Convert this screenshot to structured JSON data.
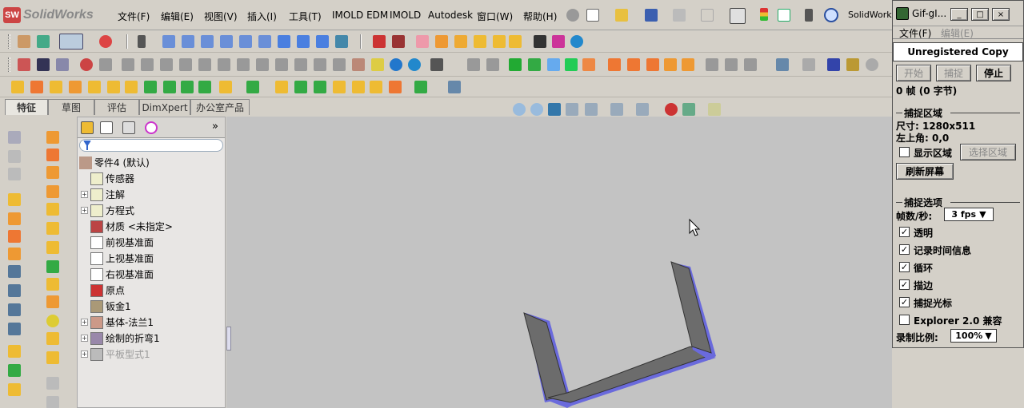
{
  "app": {
    "name": "SolidWorks",
    "logo_letters": "SW"
  },
  "menu": [
    "文件(F)",
    "编辑(E)",
    "视图(V)",
    "插入(I)",
    "工具(T)",
    "IMOLD EDM",
    "IMOLD",
    "Autodesk",
    "窗口(W)",
    "帮助(H)"
  ],
  "search": {
    "label": "SolidWorks"
  },
  "tabs": [
    "特征",
    "草图",
    "评估",
    "DimXpert",
    "办公室产品"
  ],
  "tree": {
    "root": "零件4 (默认)",
    "items": [
      {
        "label": "传感器",
        "expand": false
      },
      {
        "label": "注解",
        "expand": true
      },
      {
        "label": "方程式",
        "expand": true
      },
      {
        "label": "材质 <未指定>",
        "expand": false
      },
      {
        "label": "前视基准面",
        "expand": false
      },
      {
        "label": "上视基准面",
        "expand": false
      },
      {
        "label": "右视基准面",
        "expand": false
      },
      {
        "label": "原点",
        "expand": false
      },
      {
        "label": "钣金1",
        "expand": false
      },
      {
        "label": "基体-法兰1",
        "expand": true
      },
      {
        "label": "绘制的折弯1",
        "expand": true
      },
      {
        "label": "平板型式1",
        "expand": true,
        "dimmed": true
      }
    ],
    "collapse_label": "»"
  },
  "gif": {
    "title": "Gif-gI...",
    "menu": [
      "文件(F)",
      "编辑(E)"
    ],
    "unregistered": "Unregistered Copy",
    "buttons": {
      "start": "开始",
      "capture": "捕捉",
      "stop": "停止"
    },
    "frames": "0 帧 (0 字节)",
    "area_section": "捕捉区域",
    "size": "尺寸: 1280x511",
    "topleft": "左上角: 0,0",
    "show_area": "显示区域",
    "select_area": "选择区域",
    "refresh": "刷新屏幕",
    "options_section": "捕捉选项",
    "fps_label": "帧数/秒:",
    "fps_value": "3 fps",
    "options": [
      {
        "label": "透明",
        "checked": true
      },
      {
        "label": "记录时间信息",
        "checked": true
      },
      {
        "label": "循环",
        "checked": true
      },
      {
        "label": "描边",
        "checked": true
      },
      {
        "label": "捕捉光标",
        "checked": true
      },
      {
        "label": "Explorer 2.0 兼容",
        "checked": false
      }
    ],
    "show_area_checked": false,
    "scale_label": "录制比例:",
    "scale_value": "100%"
  },
  "colors": {
    "part_face": "#6c6c6c",
    "part_edge": "#6a6adc",
    "viewport": "#c3c3c3"
  }
}
